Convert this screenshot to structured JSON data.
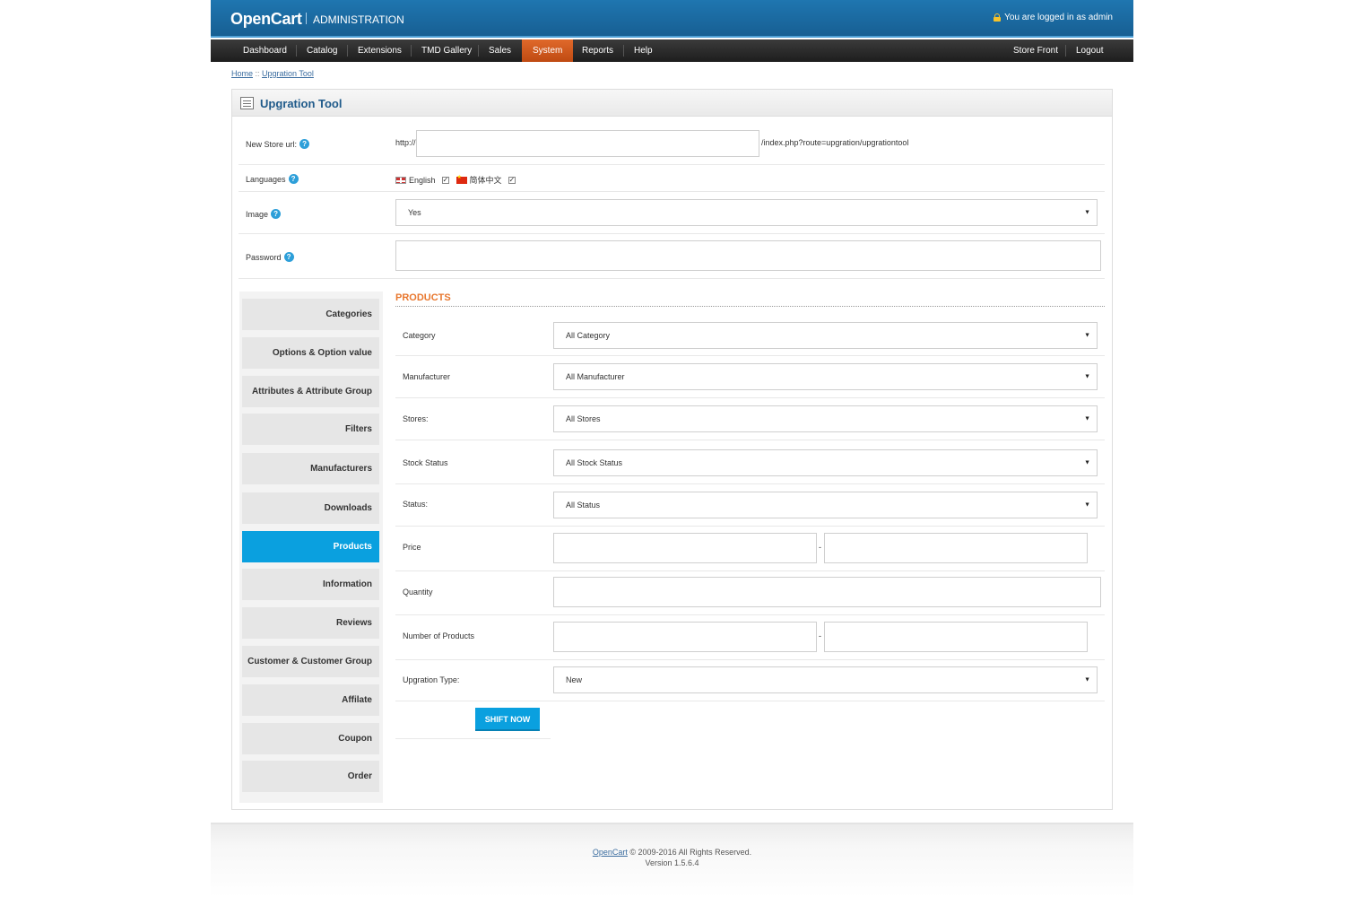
{
  "header": {
    "logo": "OpenCart",
    "subtitle": "ADMINISTRATION",
    "login_text": "You are logged in as admin"
  },
  "menu": {
    "items": [
      "Dashboard",
      "Catalog",
      "Extensions",
      "TMD Gallery",
      "Sales",
      "System",
      "Reports",
      "Help"
    ],
    "active": "System",
    "right": [
      "Store Front",
      "Logout"
    ]
  },
  "breadcrumb": {
    "home": "Home",
    "sep": " :: ",
    "current": "Upgration Tool"
  },
  "panel": {
    "title": "Upgration Tool"
  },
  "form": {
    "new_store_url": {
      "label": "New Store url:",
      "prefix": "http://",
      "value": "",
      "suffix": "/index.php?route=upgration/upgrationtool"
    },
    "languages": {
      "label": "Languages",
      "options": [
        {
          "name": "English",
          "checked": true
        },
        {
          "name": "简体中文",
          "checked": true
        }
      ]
    },
    "image": {
      "label": "Image",
      "value": "Yes"
    },
    "password": {
      "label": "Password",
      "value": ""
    }
  },
  "tabs": [
    "Categories",
    "Options & Option value",
    "Attributes & Attribute Group",
    "Filters",
    "Manufacturers",
    "Downloads",
    "Products",
    "Information",
    "Reviews",
    "Customer & Customer Group",
    "Affilate",
    "Coupon",
    "Order"
  ],
  "active_tab": "Products",
  "products": {
    "title": "PRODUCTS",
    "category": {
      "label": "Category",
      "value": "All Category"
    },
    "manufacturer": {
      "label": "Manufacturer",
      "value": "All Manufacturer"
    },
    "stores": {
      "label": "Stores:",
      "value": "All Stores"
    },
    "stock_status": {
      "label": "Stock Status",
      "value": "All Stock Status"
    },
    "status": {
      "label": "Status:",
      "value": "All Status"
    },
    "price": {
      "label": "Price",
      "sep": "-"
    },
    "quantity": {
      "label": "Quantity"
    },
    "number_of_products": {
      "label": "Number of Products",
      "sep": "-"
    },
    "upgration_type": {
      "label": "Upgration Type:",
      "value": "New"
    },
    "shift_button": "SHIFT NOW"
  },
  "footer": {
    "brand": "OpenCart",
    "copyright": "© 2009-2016 All Rights Reserved.",
    "version": "Version 1.5.6.4"
  },
  "colors": {
    "header": "#1f76b0",
    "active_menu": "#e0692b",
    "accent": "#0aa0df",
    "section_title": "#e8772e"
  }
}
